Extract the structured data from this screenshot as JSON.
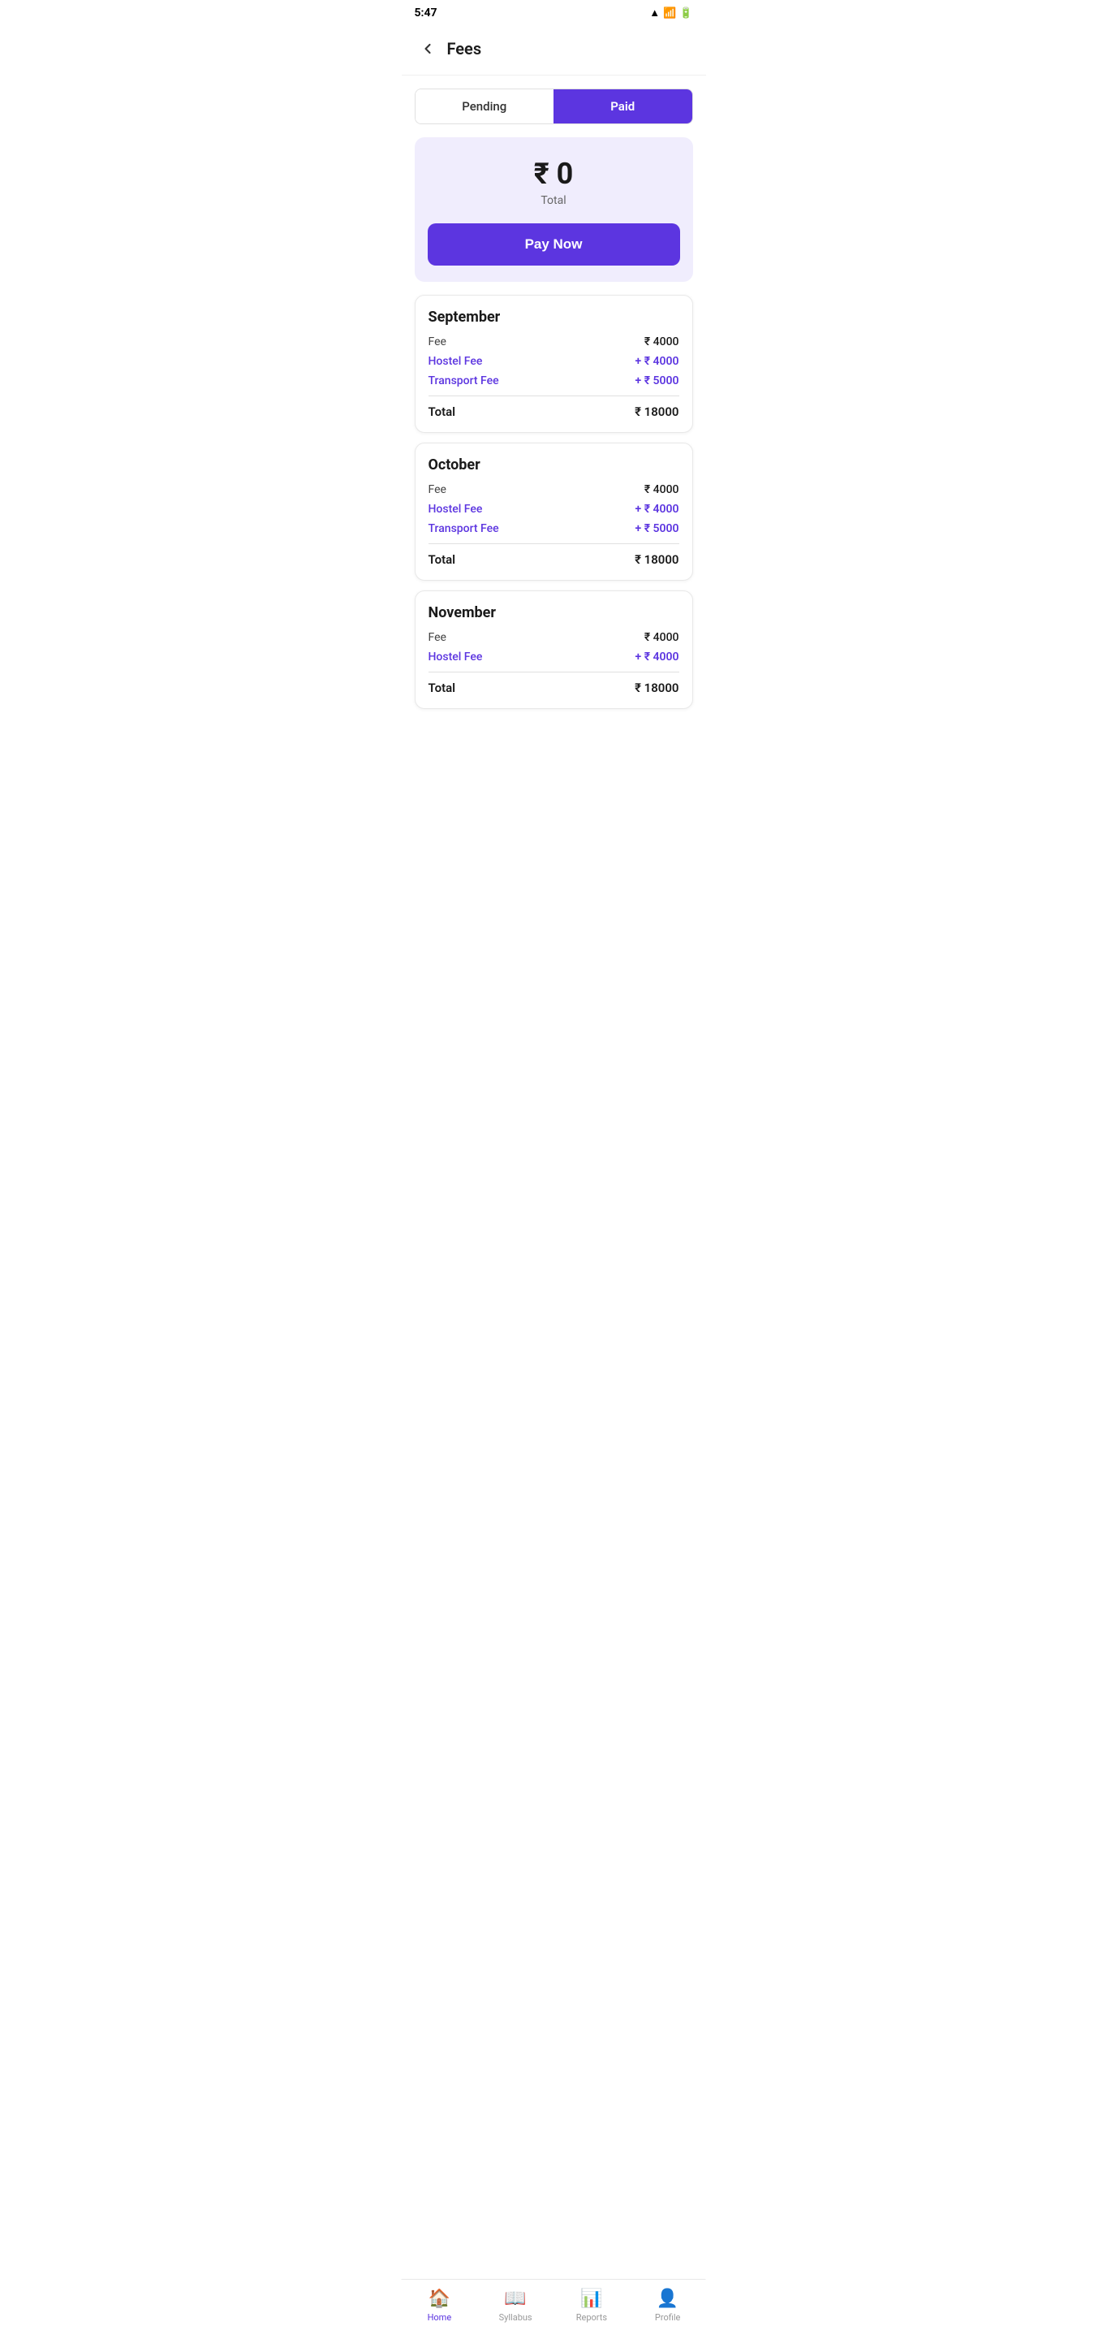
{
  "statusBar": {
    "time": "5:47",
    "icons": [
      "wifi",
      "signal",
      "battery"
    ]
  },
  "header": {
    "backLabel": "←",
    "title": "Fees"
  },
  "tabs": [
    {
      "id": "pending",
      "label": "Pending",
      "active": false
    },
    {
      "id": "paid",
      "label": "Paid",
      "active": true
    }
  ],
  "summary": {
    "currencySymbol": "₹",
    "amount": "0",
    "label": "Total",
    "payNowLabel": "Pay Now"
  },
  "feeCards": [
    {
      "month": "September",
      "feeLabel": "Fee",
      "feeAmount": "₹ 4000",
      "addons": [
        {
          "label": "Hostel Fee",
          "amount": "+ ₹ 4000"
        },
        {
          "label": "Transport Fee",
          "amount": "+ ₹ 5000"
        }
      ],
      "totalLabel": "Total",
      "totalAmount": "₹ 18000"
    },
    {
      "month": "October",
      "feeLabel": "Fee",
      "feeAmount": "₹ 4000",
      "addons": [
        {
          "label": "Hostel Fee",
          "amount": "+ ₹ 4000"
        },
        {
          "label": "Transport Fee",
          "amount": "+ ₹ 5000"
        }
      ],
      "totalLabel": "Total",
      "totalAmount": "₹ 18000"
    },
    {
      "month": "November",
      "feeLabel": "Fee",
      "feeAmount": "₹ 4000",
      "addons": [
        {
          "label": "Hostel Fee",
          "amount": "+ ₹ 4000"
        }
      ],
      "totalLabel": "Total",
      "totalAmount": "₹ 18000"
    }
  ],
  "bottomNav": [
    {
      "id": "home",
      "label": "Home",
      "icon": "🏠",
      "active": true
    },
    {
      "id": "syllabus",
      "label": "Syllabus",
      "icon": "📖",
      "active": false
    },
    {
      "id": "reports",
      "label": "Reports",
      "icon": "📊",
      "active": false
    },
    {
      "id": "profile",
      "label": "Profile",
      "icon": "👤",
      "active": false
    }
  ]
}
